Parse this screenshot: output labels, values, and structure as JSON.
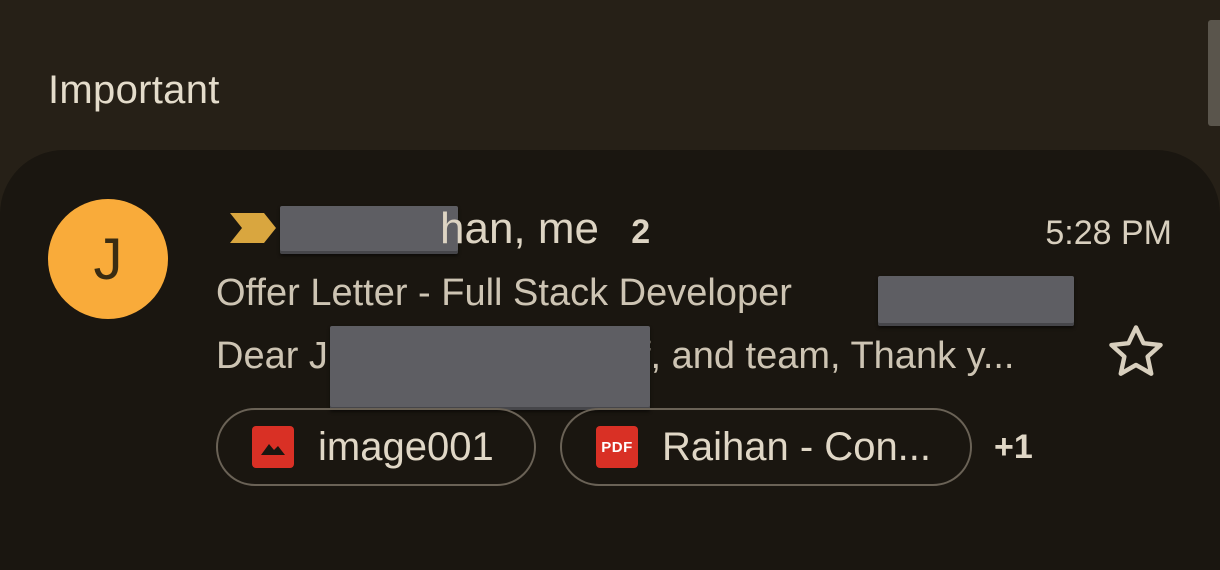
{
  "section": {
    "title": "Important"
  },
  "email": {
    "avatar_initial": "J",
    "avatar_color": "#f9ab3a",
    "importance_marker": "importance-marker-icon",
    "sender_visible": "han, me",
    "thread_count": "2",
    "time": "5:28 PM",
    "subject": "Offer Letter - Full Stack Developer",
    "snippet_prefix": "Dear J",
    "snippet_suffix": "f, and team, Thank y...",
    "starred": false,
    "attachments": [
      {
        "name": "image001",
        "icon": "image-icon"
      },
      {
        "name": "Raihan - Con...",
        "icon": "pdf-icon",
        "icon_text": "PDF"
      }
    ],
    "more_attachments": "+1"
  },
  "colors": {
    "background": "#262017",
    "card": "#1a1610",
    "accent": "#f9ab3a",
    "attachment_icon": "#d93025",
    "redaction": "#5e5e63"
  }
}
